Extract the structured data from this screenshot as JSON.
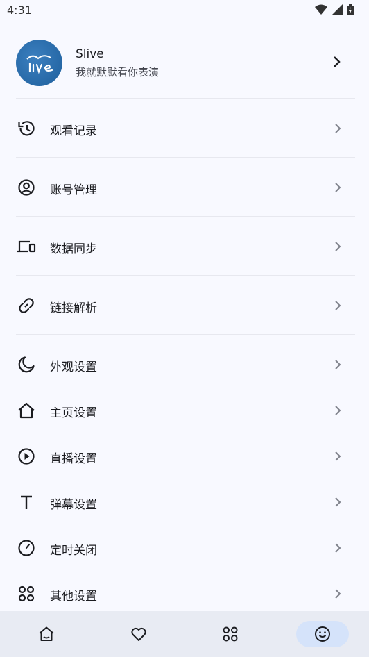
{
  "status_bar": {
    "time": "4:31"
  },
  "profile": {
    "name": "Slive",
    "subtitle": "我就默默看你表演"
  },
  "menu": [
    {
      "label": "观看记录",
      "icon": "history-icon"
    },
    {
      "label": "账号管理",
      "icon": "account-icon"
    },
    {
      "label": "数据同步",
      "icon": "devices-icon"
    },
    {
      "label": "链接解析",
      "icon": "link-icon"
    },
    {
      "label": "外观设置",
      "icon": "moon-icon"
    },
    {
      "label": "主页设置",
      "icon": "home-icon"
    },
    {
      "label": "直播设置",
      "icon": "play-circle-icon"
    },
    {
      "label": "弹幕设置",
      "icon": "text-icon"
    },
    {
      "label": "定时关闭",
      "icon": "timer-icon"
    },
    {
      "label": "其他设置",
      "icon": "apps-icon"
    }
  ],
  "bottom_nav": [
    {
      "icon": "home-icon",
      "active": false
    },
    {
      "icon": "heart-icon",
      "active": false
    },
    {
      "icon": "apps-icon",
      "active": false
    },
    {
      "icon": "smile-icon",
      "active": true
    }
  ],
  "colors": {
    "background": "#f8f9ff",
    "nav_background": "#e8ebf3",
    "nav_active": "#d5e3fa",
    "avatar": "#2a6aa9"
  }
}
